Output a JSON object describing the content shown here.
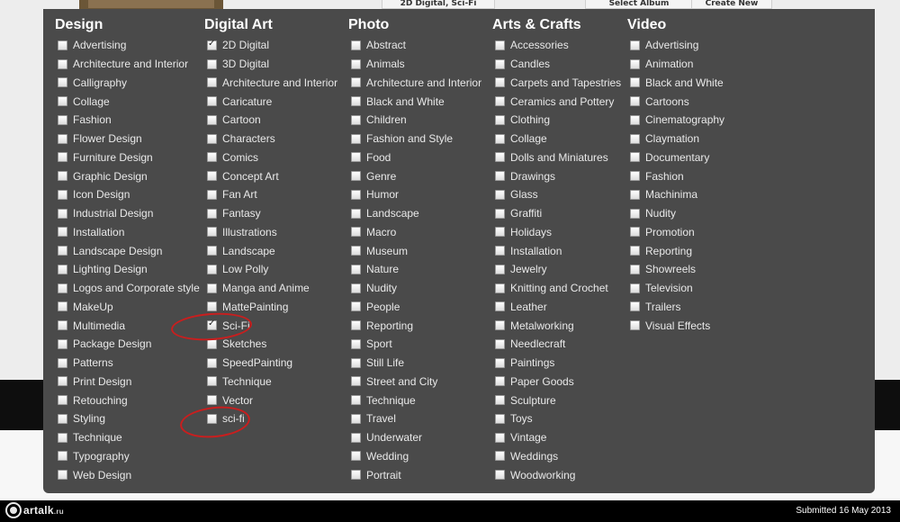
{
  "top_bar": {
    "tags_value": "2D Digital, Sci-Fi",
    "select_album": "Select Album",
    "create_new": "Create New"
  },
  "columns": [
    {
      "title": "Design",
      "items": [
        {
          "label": "Advertising",
          "checked": false
        },
        {
          "label": "Architecture and Interior",
          "checked": false
        },
        {
          "label": "Calligraphy",
          "checked": false
        },
        {
          "label": "Collage",
          "checked": false
        },
        {
          "label": "Fashion",
          "checked": false
        },
        {
          "label": "Flower Design",
          "checked": false
        },
        {
          "label": "Furniture Design",
          "checked": false
        },
        {
          "label": "Graphic Design",
          "checked": false
        },
        {
          "label": "Icon Design",
          "checked": false
        },
        {
          "label": "Industrial Design",
          "checked": false
        },
        {
          "label": "Installation",
          "checked": false
        },
        {
          "label": "Landscape Design",
          "checked": false
        },
        {
          "label": "Lighting Design",
          "checked": false
        },
        {
          "label": "Logos and Corporate style",
          "checked": false
        },
        {
          "label": "MakeUp",
          "checked": false
        },
        {
          "label": "Multimedia",
          "checked": false
        },
        {
          "label": "Package Design",
          "checked": false
        },
        {
          "label": "Patterns",
          "checked": false
        },
        {
          "label": "Print Design",
          "checked": false
        },
        {
          "label": "Retouching",
          "checked": false
        },
        {
          "label": "Styling",
          "checked": false
        },
        {
          "label": "Technique",
          "checked": false
        },
        {
          "label": "Typography",
          "checked": false
        },
        {
          "label": "Web Design",
          "checked": false
        }
      ]
    },
    {
      "title": "Digital Art",
      "items": [
        {
          "label": "2D Digital",
          "checked": true
        },
        {
          "label": "3D Digital",
          "checked": false
        },
        {
          "label": "Architecture and Interior",
          "checked": false
        },
        {
          "label": "Caricature",
          "checked": false
        },
        {
          "label": "Cartoon",
          "checked": false
        },
        {
          "label": "Characters",
          "checked": false
        },
        {
          "label": "Comics",
          "checked": false
        },
        {
          "label": "Concept Art",
          "checked": false
        },
        {
          "label": "Fan Art",
          "checked": false
        },
        {
          "label": "Fantasy",
          "checked": false
        },
        {
          "label": "Illustrations",
          "checked": false
        },
        {
          "label": "Landscape",
          "checked": false
        },
        {
          "label": "Low Polly",
          "checked": false
        },
        {
          "label": "Manga and Anime",
          "checked": false
        },
        {
          "label": "MattePainting",
          "checked": false
        },
        {
          "label": "Sci-Fi",
          "checked": true
        },
        {
          "label": "Sketches",
          "checked": false
        },
        {
          "label": "SpeedPainting",
          "checked": false
        },
        {
          "label": "Technique",
          "checked": false
        },
        {
          "label": "Vector",
          "checked": false
        },
        {
          "label": "sci-fi",
          "checked": false
        }
      ]
    },
    {
      "title": "Photo",
      "items": [
        {
          "label": "Abstract",
          "checked": false
        },
        {
          "label": "Animals",
          "checked": false
        },
        {
          "label": "Architecture and Interior",
          "checked": false
        },
        {
          "label": "Black and White",
          "checked": false
        },
        {
          "label": "Children",
          "checked": false
        },
        {
          "label": "Fashion and Style",
          "checked": false
        },
        {
          "label": "Food",
          "checked": false
        },
        {
          "label": "Genre",
          "checked": false
        },
        {
          "label": "Humor",
          "checked": false
        },
        {
          "label": "Landscape",
          "checked": false
        },
        {
          "label": "Macro",
          "checked": false
        },
        {
          "label": "Museum",
          "checked": false
        },
        {
          "label": "Nature",
          "checked": false
        },
        {
          "label": "Nudity",
          "checked": false
        },
        {
          "label": "People",
          "checked": false
        },
        {
          "label": "Reporting",
          "checked": false
        },
        {
          "label": "Sport",
          "checked": false
        },
        {
          "label": "Still Life",
          "checked": false
        },
        {
          "label": "Street and City",
          "checked": false
        },
        {
          "label": "Technique",
          "checked": false
        },
        {
          "label": "Travel",
          "checked": false
        },
        {
          "label": "Underwater",
          "checked": false
        },
        {
          "label": "Wedding",
          "checked": false
        },
        {
          "label": "Portrait",
          "checked": false
        }
      ]
    },
    {
      "title": "Arts & Crafts",
      "items": [
        {
          "label": "Accessories",
          "checked": false
        },
        {
          "label": "Candles",
          "checked": false
        },
        {
          "label": "Carpets and Tapestries",
          "checked": false
        },
        {
          "label": "Ceramics and Pottery",
          "checked": false
        },
        {
          "label": "Clothing",
          "checked": false
        },
        {
          "label": "Collage",
          "checked": false
        },
        {
          "label": "Dolls and Miniatures",
          "checked": false
        },
        {
          "label": "Drawings",
          "checked": false
        },
        {
          "label": "Glass",
          "checked": false
        },
        {
          "label": "Graffiti",
          "checked": false
        },
        {
          "label": "Holidays",
          "checked": false
        },
        {
          "label": "Installation",
          "checked": false
        },
        {
          "label": "Jewelry",
          "checked": false
        },
        {
          "label": "Knitting and Crochet",
          "checked": false
        },
        {
          "label": "Leather",
          "checked": false
        },
        {
          "label": "Metalworking",
          "checked": false
        },
        {
          "label": "Needlecraft",
          "checked": false
        },
        {
          "label": "Paintings",
          "checked": false
        },
        {
          "label": "Paper Goods",
          "checked": false
        },
        {
          "label": "Sculpture",
          "checked": false
        },
        {
          "label": "Toys",
          "checked": false
        },
        {
          "label": "Vintage",
          "checked": false
        },
        {
          "label": "Weddings",
          "checked": false
        },
        {
          "label": "Woodworking",
          "checked": false
        }
      ]
    },
    {
      "title": "Video",
      "items": [
        {
          "label": "Advertising",
          "checked": false
        },
        {
          "label": "Animation",
          "checked": false
        },
        {
          "label": "Black and White",
          "checked": false
        },
        {
          "label": "Cartoons",
          "checked": false
        },
        {
          "label": "Cinematography",
          "checked": false
        },
        {
          "label": "Claymation",
          "checked": false
        },
        {
          "label": "Documentary",
          "checked": false
        },
        {
          "label": "Fashion",
          "checked": false
        },
        {
          "label": "Machinima",
          "checked": false
        },
        {
          "label": "Nudity",
          "checked": false
        },
        {
          "label": "Promotion",
          "checked": false
        },
        {
          "label": "Reporting",
          "checked": false
        },
        {
          "label": "Showreels",
          "checked": false
        },
        {
          "label": "Television",
          "checked": false
        },
        {
          "label": "Trailers",
          "checked": false
        },
        {
          "label": "Visual Effects",
          "checked": false
        }
      ]
    }
  ],
  "footer": {
    "logo_text": "artalk",
    "logo_tld": ".ru",
    "submitted": "Submitted 16 May 2013"
  },
  "colors": {
    "panel": "#4a4a4a",
    "annotation": "#c91e1e",
    "footer": "#000000"
  }
}
